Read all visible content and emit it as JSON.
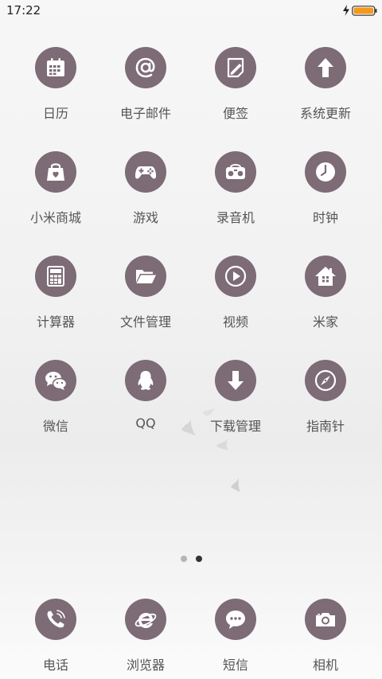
{
  "status_bar": {
    "time": "17:22"
  },
  "colors": {
    "icon_bg": "#7d6b76",
    "icon_fg": "#ffffff",
    "label": "#555555",
    "battery": "#f39a1e"
  },
  "pages": {
    "total": 2,
    "current": 2
  },
  "apps": [
    {
      "label": "日历",
      "icon": "calendar-icon"
    },
    {
      "label": "电子邮件",
      "icon": "at-sign-icon"
    },
    {
      "label": "便签",
      "icon": "notes-icon"
    },
    {
      "label": "系统更新",
      "icon": "arrow-up-icon"
    },
    {
      "label": "小米商城",
      "icon": "shopping-bag-icon"
    },
    {
      "label": "游戏",
      "icon": "gamepad-icon"
    },
    {
      "label": "录音机",
      "icon": "recorder-icon"
    },
    {
      "label": "时钟",
      "icon": "clock-icon"
    },
    {
      "label": "计算器",
      "icon": "calculator-icon"
    },
    {
      "label": "文件管理",
      "icon": "folder-icon"
    },
    {
      "label": "视频",
      "icon": "play-icon"
    },
    {
      "label": "米家",
      "icon": "home-icon"
    },
    {
      "label": "微信",
      "icon": "wechat-icon"
    },
    {
      "label": "QQ",
      "icon": "qq-penguin-icon"
    },
    {
      "label": "下载管理",
      "icon": "download-icon"
    },
    {
      "label": "指南针",
      "icon": "compass-icon"
    }
  ],
  "dock": [
    {
      "label": "电话",
      "icon": "phone-icon"
    },
    {
      "label": "浏览器",
      "icon": "browser-icon"
    },
    {
      "label": "短信",
      "icon": "message-icon"
    },
    {
      "label": "相机",
      "icon": "camera-icon"
    }
  ]
}
